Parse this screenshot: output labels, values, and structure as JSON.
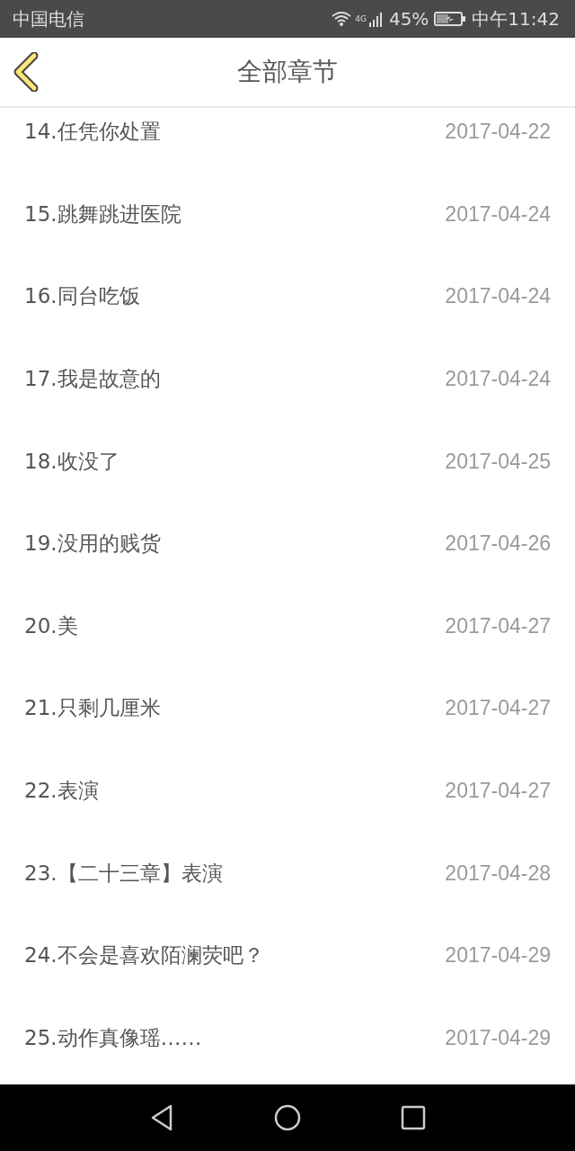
{
  "status_bar": {
    "carrier": "中国电信",
    "network": "4G",
    "battery": "45%",
    "time": "中午11:42"
  },
  "header": {
    "title": "全部章节"
  },
  "chapters": [
    {
      "title": "14.任凭你处置",
      "date": "2017-04-22"
    },
    {
      "title": "15.跳舞跳进医院",
      "date": "2017-04-24"
    },
    {
      "title": "16.同台吃饭",
      "date": "2017-04-24"
    },
    {
      "title": "17.我是故意的",
      "date": "2017-04-24"
    },
    {
      "title": "18.收没了",
      "date": "2017-04-25"
    },
    {
      "title": "19.没用的贱货",
      "date": "2017-04-26"
    },
    {
      "title": "20.美",
      "date": "2017-04-27"
    },
    {
      "title": "21.只剩几厘米",
      "date": "2017-04-27"
    },
    {
      "title": "22.表演",
      "date": "2017-04-27"
    },
    {
      "title": "23.【二十三章】表演",
      "date": "2017-04-28"
    },
    {
      "title": "24.不会是喜欢陌澜荧吧？",
      "date": "2017-04-29"
    },
    {
      "title": "25.动作真像瑶……",
      "date": "2017-04-29"
    }
  ]
}
